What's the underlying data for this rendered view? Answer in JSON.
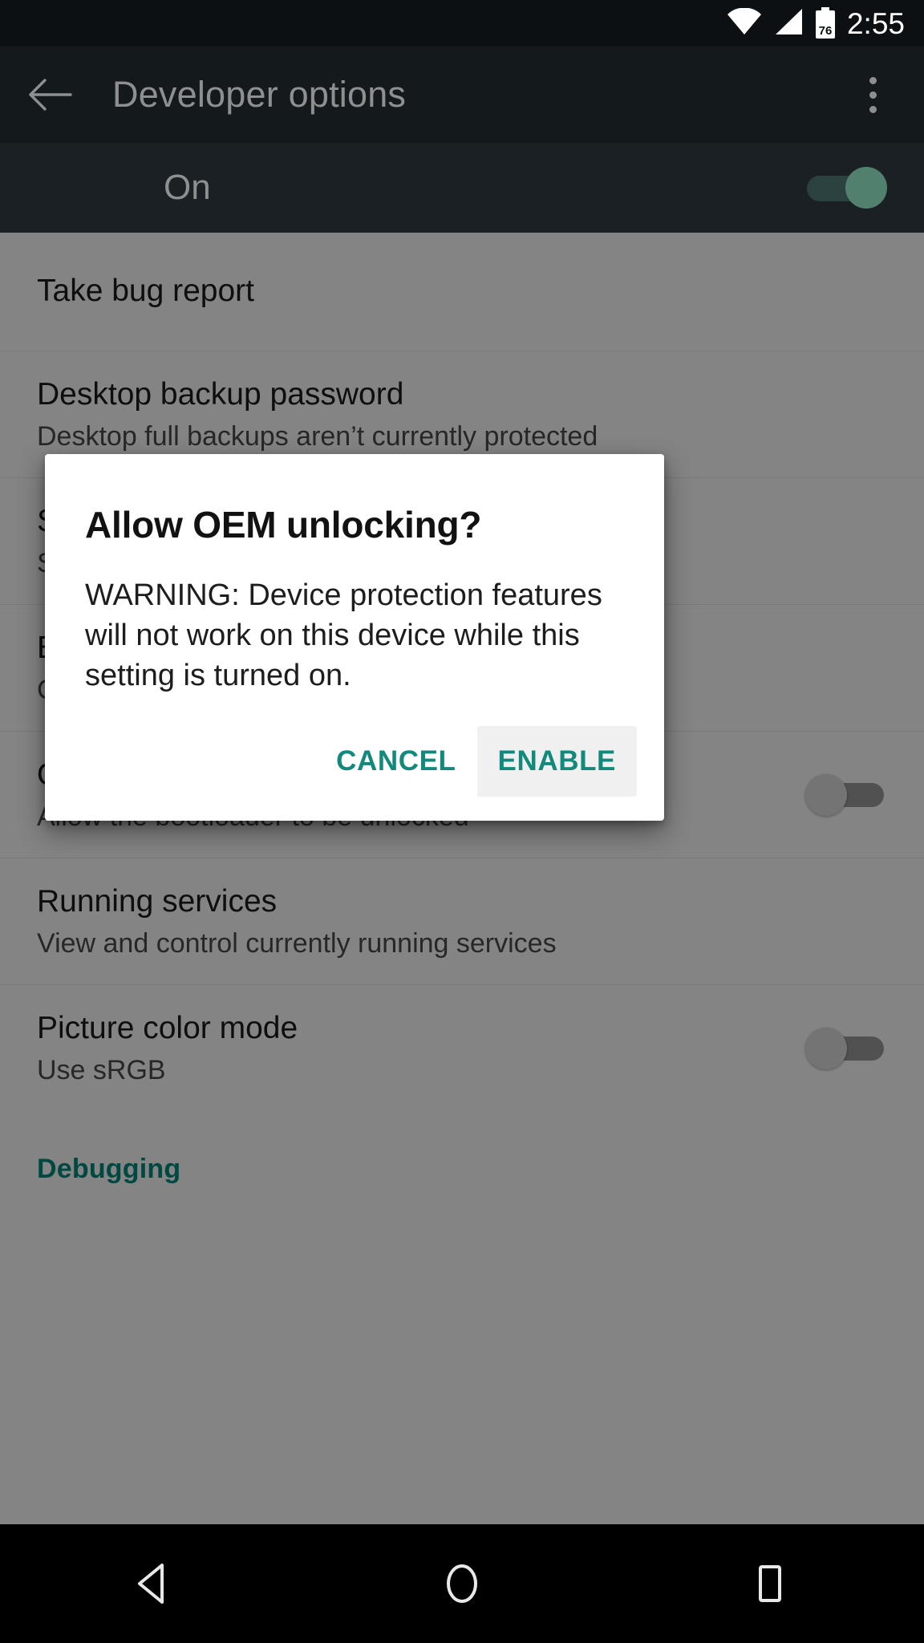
{
  "status_bar": {
    "wifi_icon": "wifi-icon",
    "signal_icon": "cellular-signal-icon",
    "battery_icon": "battery-icon",
    "battery_level": "76",
    "time": "2:55"
  },
  "app_bar": {
    "back_icon": "back-arrow-icon",
    "title": "Developer options",
    "overflow_icon": "overflow-menu-icon"
  },
  "master_switch": {
    "label": "On",
    "state": "on"
  },
  "settings_rows": [
    {
      "title": "Take bug report",
      "subtitle": "",
      "has_switch": false
    },
    {
      "title": "Desktop backup password",
      "subtitle": "Desktop full backups aren’t currently protected",
      "has_switch": false
    },
    {
      "title": "S",
      "subtitle": "Se",
      "has_switch": false
    },
    {
      "title": "E",
      "subtitle": "C",
      "has_switch": false
    },
    {
      "title": "OEM unlocking",
      "subtitle": "Allow the bootloader to be unlocked",
      "has_switch": true,
      "switch_state": "off"
    },
    {
      "title": "Running services",
      "subtitle": "View and control currently running services",
      "has_switch": false
    },
    {
      "title": "Picture color mode",
      "subtitle": "Use sRGB",
      "has_switch": true,
      "switch_state": "off"
    }
  ],
  "section_header": "Debugging",
  "dialog": {
    "title": "Allow OEM unlocking?",
    "message": "WARNING: Device protection features will not work on this device while this setting is turned on.",
    "cancel_label": "CANCEL",
    "enable_label": "ENABLE"
  },
  "nav_bar": {
    "back_icon": "nav-back-triangle-icon",
    "home_icon": "nav-home-circle-icon",
    "recents_icon": "nav-recents-square-icon"
  },
  "colors": {
    "accent_teal": "#00897b",
    "dialog_action_teal": "#12897c",
    "status_bar_bg": "#0d1012",
    "app_bar_bg": "#141a1c",
    "master_bar_bg": "#1a2023"
  }
}
